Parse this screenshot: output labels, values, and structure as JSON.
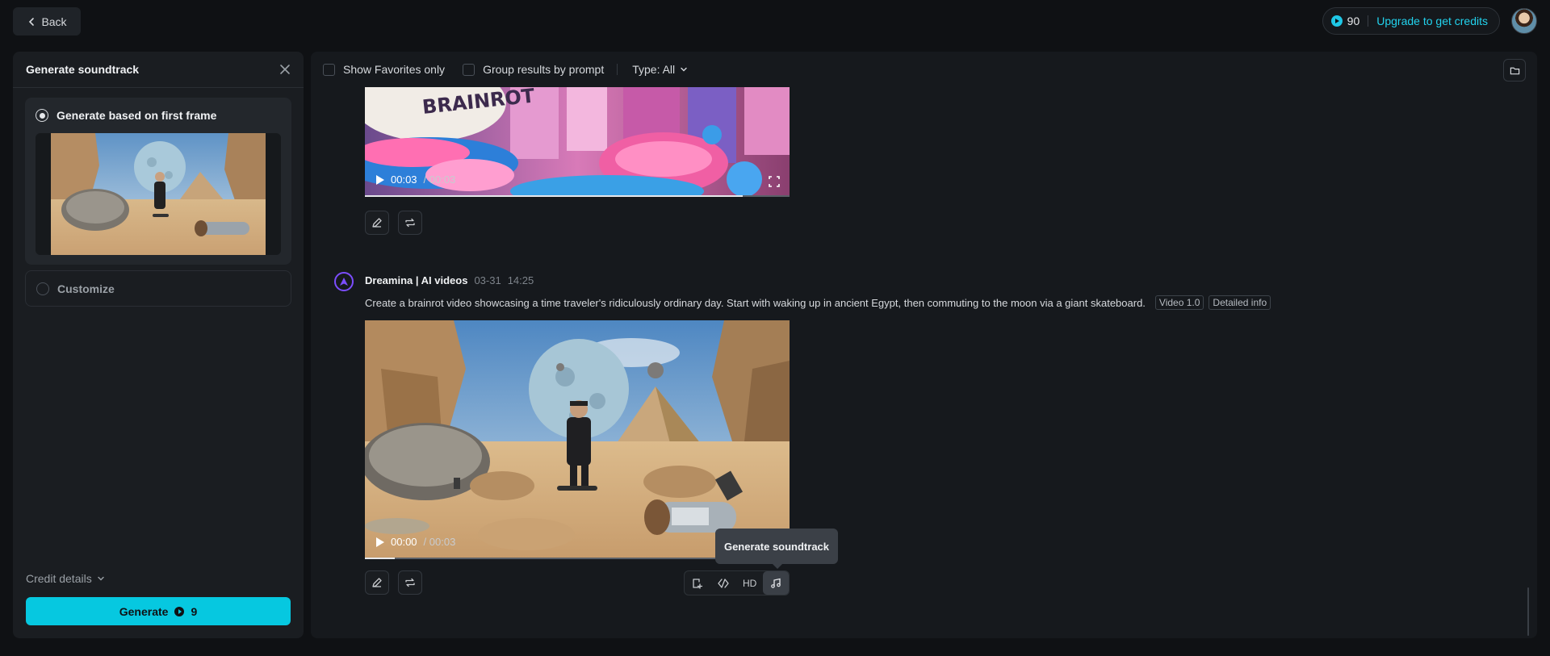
{
  "header": {
    "back_label": "Back",
    "credits": "90",
    "upgrade_label": "Upgrade to get credits"
  },
  "left_panel": {
    "title": "Generate soundtrack",
    "option_first_frame": "Generate based on first frame",
    "option_customize": "Customize",
    "credit_details_label": "Credit details",
    "generate_label": "Generate",
    "generate_cost": "9"
  },
  "toolbar": {
    "favorites_label": "Show Favorites only",
    "group_label": "Group results by prompt",
    "type_label": "Type: All"
  },
  "video1": {
    "current_time": "00:03",
    "duration": "/ 00:03",
    "progress": 0.89
  },
  "result": {
    "author": "Dreamina | AI videos",
    "date": "03-31",
    "time": "14:25",
    "prompt": "Create a brainrot video showcasing a time traveler's ridiculously ordinary day. Start with waking up in ancient Egypt, then commuting to the moon via a giant skateboard.",
    "tag_model": "Video 1.0",
    "tag_info": "Detailed info"
  },
  "video2": {
    "current_time": "00:00",
    "duration": "/ 00:03",
    "progress": 0.07
  },
  "tools": {
    "hd_label": "HD",
    "tooltip": "Generate soundtrack"
  },
  "colors": {
    "accent": "#06c8e0",
    "upgrade": "#22d3ee",
    "brand": "#7c4dff"
  }
}
